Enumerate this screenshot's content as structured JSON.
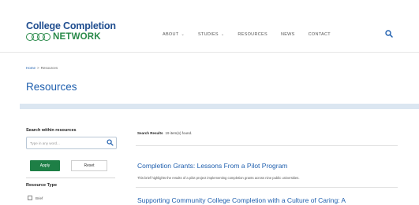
{
  "logo": {
    "line1": "College Completion",
    "line2": "NETWORK"
  },
  "nav": {
    "items": [
      {
        "label": "ABOUT",
        "has_dropdown": true
      },
      {
        "label": "STUDIES",
        "has_dropdown": true
      },
      {
        "label": "RESOURCES",
        "has_dropdown": false
      },
      {
        "label": "NEWS",
        "has_dropdown": false
      },
      {
        "label": "CONTACT",
        "has_dropdown": false
      }
    ],
    "dropdown_glyph": "⌄",
    "search_icon": "search-icon"
  },
  "breadcrumb": {
    "home": "Home",
    "separator": ">",
    "current": "Resources"
  },
  "page_title": "Resources",
  "sidebar": {
    "search_heading": "Search within resources",
    "search_placeholder": "Type in any word...",
    "search_value": "",
    "apply_label": "Apply",
    "reset_label": "Reset",
    "resource_type_heading": "Resource Type",
    "resource_type_options": [
      {
        "label": "Brief",
        "checked": false
      }
    ]
  },
  "results": {
    "meta_label": "Search Results",
    "meta_count_text": "19 item(s) found.",
    "items": [
      {
        "title": "Completion Grants: Lessons From a Pilot Program",
        "description": "This brief highlights the results of a pilot project implementing completion grants across nine public universities."
      },
      {
        "title": "Supporting Community College Completion with a Culture of Caring: A",
        "description": ""
      }
    ]
  },
  "colors": {
    "brand_blue": "#1f5fae",
    "brand_green": "#1e7f46",
    "band": "#dbe6f1"
  }
}
